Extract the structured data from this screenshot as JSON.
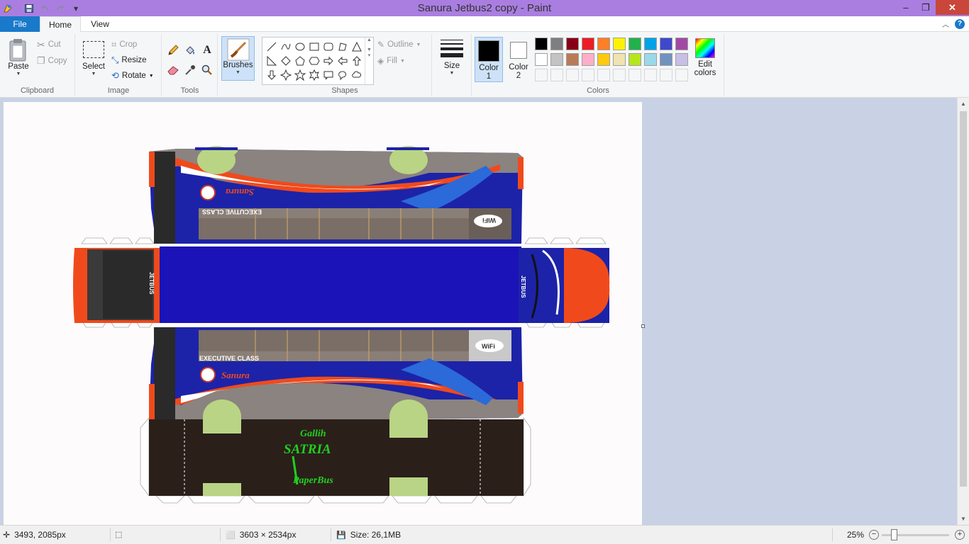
{
  "window": {
    "title": "Sanura Jetbus2 copy - Paint",
    "controls": {
      "minimize": "–",
      "maximize": "❐",
      "close": "✕"
    }
  },
  "quick_access": {
    "save_icon": "save-icon",
    "undo_icon": "undo-icon",
    "redo_icon": "redo-icon",
    "customize": "▾"
  },
  "tabs": {
    "file": "File",
    "home": "Home",
    "view": "View"
  },
  "ribbon": {
    "clipboard": {
      "group": "Clipboard",
      "paste": "Paste",
      "cut": "Cut",
      "copy": "Copy"
    },
    "image": {
      "group": "Image",
      "select": "Select",
      "crop": "Crop",
      "resize": "Resize",
      "rotate": "Rotate"
    },
    "tools": {
      "group": "Tools"
    },
    "brushes": {
      "label": "Brushes"
    },
    "shapes": {
      "group": "Shapes",
      "outline": "Outline",
      "fill": "Fill"
    },
    "size": {
      "label": "Size"
    },
    "colors": {
      "group": "Colors",
      "color1": "Color",
      "color1_num": "1",
      "color2": "Color",
      "color2_num": "2",
      "edit": "Edit",
      "edit2": "colors",
      "color1_value": "#000000",
      "color2_value": "#ffffff",
      "palette_row1": [
        "#000000",
        "#7f7f7f",
        "#880015",
        "#ed1c24",
        "#ff7f27",
        "#fff200",
        "#22b14c",
        "#00a2e8",
        "#3f48cc",
        "#a349a4"
      ],
      "palette_row2": [
        "#ffffff",
        "#c3c3c3",
        "#b97a57",
        "#ffaec9",
        "#ffc90e",
        "#efe4b0",
        "#b5e61d",
        "#99d9ea",
        "#7092be",
        "#c8bfe7"
      ]
    }
  },
  "artwork": {
    "upper_side": {
      "class_text": "EXECUTIVE CLASS",
      "brand": "Sanura",
      "badge": "WiFi"
    },
    "lower_side": {
      "class_text": "EXECUTIVE CLASS",
      "brand": "Sanura",
      "badge": "WiFi"
    },
    "front": {
      "brand": "Sanura",
      "model": "JETBUS"
    },
    "rear": {
      "model": "JETBUS"
    },
    "signature": {
      "line1": "Gallih",
      "line2": "SATRIA",
      "line3": "PaperBus"
    },
    "colors": {
      "body_blue": "#1c23a8",
      "accent_orange": "#f04a1c",
      "window_grey": "#7a6e66",
      "base_dark": "#2b1f1a",
      "wheel_green": "#b9d484",
      "sign_green": "#1fd11f"
    }
  },
  "status": {
    "cursor_pos": "3493, 2085px",
    "dimensions": "3603 × 2534px",
    "file_size": "Size: 26,1MB",
    "zoom": "25%"
  }
}
